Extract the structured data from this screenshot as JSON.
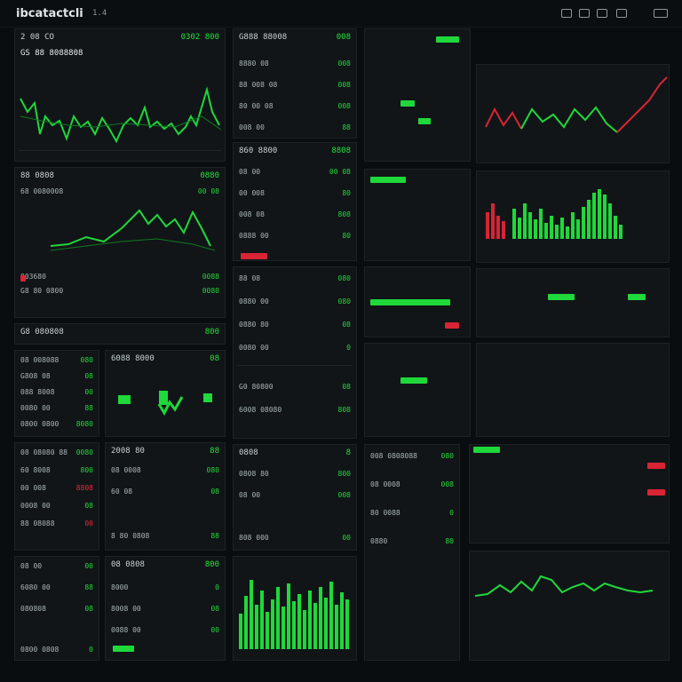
{
  "app": {
    "title": "ibcatactcli",
    "version": "1.4"
  },
  "colors": {
    "background": "#0a0d0f",
    "panel": "#111518",
    "up": "#1fd83a",
    "down": "#d92433",
    "text": "#cfd6d8"
  },
  "toolbar": {
    "icons": [
      "grid-icon",
      "window-icon",
      "copy-icon",
      "user-icon",
      "menu-icon"
    ]
  },
  "panels": {
    "p1": {
      "title": "2 08 CO",
      "value": "0302 800",
      "chart_title": "GS 88 8088808"
    },
    "p2": {
      "title": "G888 88008",
      "value": "008",
      "rows": [
        [
          "8880 08",
          "008"
        ],
        [
          "88 008 08",
          "008"
        ],
        [
          "80 00 08",
          "008"
        ],
        [
          "008 00",
          "88"
        ]
      ]
    },
    "p3": {
      "title": "003680",
      "value": "0088"
    },
    "p4": {
      "title": "88 0808",
      "value": "0880"
    },
    "p5": {
      "title": "68 0080008",
      "value": "00 08"
    },
    "p6": {
      "title": "860 8800",
      "value": "8808",
      "rows": [
        [
          "08 00",
          "00 08"
        ],
        [
          "00 008",
          "80"
        ],
        [
          "008 08",
          "808"
        ],
        [
          "0888 00",
          "80"
        ]
      ]
    },
    "p7": {
      "title": "G8 80 0800",
      "value": "0080"
    },
    "p8": {
      "title": "G8 080808",
      "value": "800"
    },
    "p9": {
      "title": "6088 8000",
      "value": "08"
    },
    "p10": {
      "title": "2008 80",
      "value": "88",
      "rows": [
        [
          "08 0008",
          "080"
        ],
        [
          "60 08",
          "08"
        ],
        [
          "8 80 0808",
          "88"
        ]
      ]
    },
    "p11": {
      "title": "08 0808",
      "value": "800"
    },
    "p12": {
      "title": "G0 80800",
      "value": "08"
    },
    "p13": {
      "title": "6008 08080",
      "value": "808"
    },
    "p14": {
      "title": "0808",
      "value": "8"
    }
  },
  "panel_rows": {
    "left_mid": [
      [
        "08 008088",
        "080"
      ],
      [
        "G808 08",
        "08"
      ],
      [
        "088 8008",
        "00"
      ],
      [
        "0080 00",
        "88"
      ],
      [
        "0800 0800",
        "8080"
      ]
    ],
    "left_low": [
      [
        "08 08080 88",
        "0080"
      ],
      [
        "60 8008",
        "800"
      ],
      [
        "00 008",
        "8808"
      ],
      [
        "0008 00",
        "08"
      ],
      [
        "88 08088",
        "00"
      ]
    ],
    "left_bottom": [
      [
        "08 00",
        "00"
      ],
      [
        "6080 00",
        "88"
      ],
      [
        "080808",
        "08"
      ],
      [
        "0800 0808",
        "0"
      ]
    ],
    "mid_low": [
      [
        "88 08",
        "080"
      ],
      [
        "0880 00",
        "080"
      ],
      [
        "0880 80",
        "08"
      ],
      [
        "0080 00",
        "0"
      ]
    ],
    "mid_bottom": [
      [
        "8000",
        "0"
      ],
      [
        "8008 00",
        "08"
      ],
      [
        "0088 00",
        "00"
      ]
    ],
    "right_mid": [
      [
        "0808 80",
        "800"
      ],
      [
        "08 00",
        "008"
      ],
      [
        "808 000",
        "00"
      ],
      [
        "0080 08",
        "88"
      ]
    ],
    "right_low": [
      [
        "008 0808088",
        "080"
      ],
      [
        "08 0008",
        "008"
      ],
      [
        "80 0088",
        "0"
      ],
      [
        "0880",
        "80"
      ]
    ]
  }
}
